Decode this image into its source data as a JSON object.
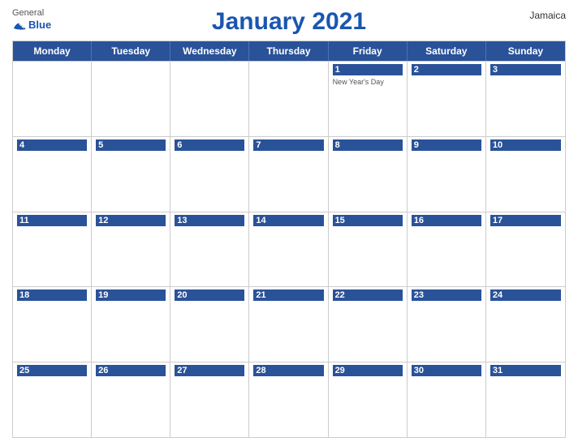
{
  "header": {
    "title": "January 2021",
    "country": "Jamaica",
    "logo_general": "General",
    "logo_blue": "Blue"
  },
  "days_of_week": [
    "Monday",
    "Tuesday",
    "Wednesday",
    "Thursday",
    "Friday",
    "Saturday",
    "Sunday"
  ],
  "weeks": [
    [
      {
        "day": "",
        "event": ""
      },
      {
        "day": "",
        "event": ""
      },
      {
        "day": "",
        "event": ""
      },
      {
        "day": "",
        "event": ""
      },
      {
        "day": "1",
        "event": "New Year's Day"
      },
      {
        "day": "2",
        "event": ""
      },
      {
        "day": "3",
        "event": ""
      }
    ],
    [
      {
        "day": "4",
        "event": ""
      },
      {
        "day": "5",
        "event": ""
      },
      {
        "day": "6",
        "event": ""
      },
      {
        "day": "7",
        "event": ""
      },
      {
        "day": "8",
        "event": ""
      },
      {
        "day": "9",
        "event": ""
      },
      {
        "day": "10",
        "event": ""
      }
    ],
    [
      {
        "day": "11",
        "event": ""
      },
      {
        "day": "12",
        "event": ""
      },
      {
        "day": "13",
        "event": ""
      },
      {
        "day": "14",
        "event": ""
      },
      {
        "day": "15",
        "event": ""
      },
      {
        "day": "16",
        "event": ""
      },
      {
        "day": "17",
        "event": ""
      }
    ],
    [
      {
        "day": "18",
        "event": ""
      },
      {
        "day": "19",
        "event": ""
      },
      {
        "day": "20",
        "event": ""
      },
      {
        "day": "21",
        "event": ""
      },
      {
        "day": "22",
        "event": ""
      },
      {
        "day": "23",
        "event": ""
      },
      {
        "day": "24",
        "event": ""
      }
    ],
    [
      {
        "day": "25",
        "event": ""
      },
      {
        "day": "26",
        "event": ""
      },
      {
        "day": "27",
        "event": ""
      },
      {
        "day": "28",
        "event": ""
      },
      {
        "day": "29",
        "event": ""
      },
      {
        "day": "30",
        "event": ""
      },
      {
        "day": "31",
        "event": ""
      }
    ]
  ]
}
